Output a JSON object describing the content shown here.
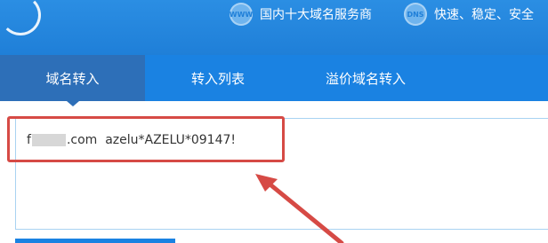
{
  "header": {
    "features": [
      {
        "icon": "www-icon",
        "badge": "WWW",
        "text": "国内十大域名服务商"
      },
      {
        "icon": "dns-icon",
        "badge": "DNS",
        "text": "快速、稳定、安全"
      }
    ],
    "colors": {
      "banner": "#1f7fd8",
      "tabbar": "#1a82e2",
      "active_tab": "#2d6fb8"
    }
  },
  "tabs": [
    {
      "label": "域名转入",
      "active": true
    },
    {
      "label": "转入列表",
      "active": false
    },
    {
      "label": "溢价域名转入",
      "active": false
    }
  ],
  "transfer_input": {
    "prefix": "f",
    "suffix": ".com  azelu*AZELU*09147!",
    "masked_segment": "redacted"
  },
  "annotation": {
    "highlight_color": "#d64a45",
    "arrow": "red-arrow-icon"
  }
}
